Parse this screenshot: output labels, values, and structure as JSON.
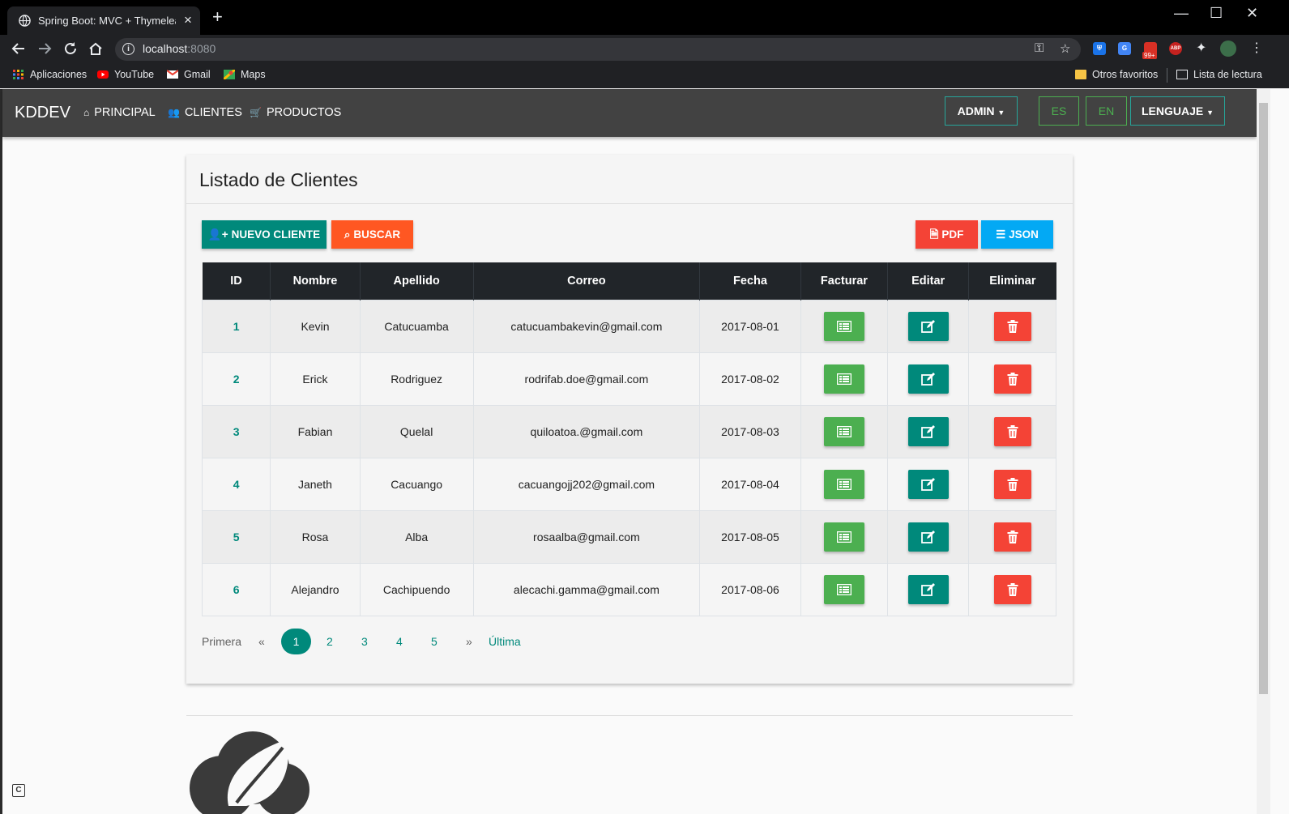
{
  "browser": {
    "tab_title": "Spring Boot: MVC + Thymeleaf +",
    "url_host": "localhost",
    "url_port": ":8080",
    "extension_badge": "99+",
    "abp_label": "ABP",
    "bookmarks": [
      {
        "label": "Aplicaciones",
        "icon": "apps-grid-icon"
      },
      {
        "label": "YouTube",
        "icon": "youtube-icon"
      },
      {
        "label": "Gmail",
        "icon": "gmail-icon"
      },
      {
        "label": "Maps",
        "icon": "maps-icon"
      }
    ],
    "other_bookmarks": "Otros favoritos",
    "reading_list": "Lista de lectura"
  },
  "navbar": {
    "brand": "KDDEV",
    "links": [
      "PRINCIPAL",
      "CLIENTES",
      "PRODUCTOS"
    ],
    "admin": "ADMIN",
    "lang_es": "ES",
    "lang_en": "EN",
    "language": "LENGUAJE"
  },
  "card": {
    "title": "Listado de Clientes",
    "new_client": "NUEVO CLIENTE",
    "search": "BUSCAR",
    "pdf": "PDF",
    "json": "JSON"
  },
  "table": {
    "headers": [
      "ID",
      "Nombre",
      "Apellido",
      "Correo",
      "Fecha",
      "Facturar",
      "Editar",
      "Eliminar"
    ],
    "rows": [
      {
        "id": "1",
        "nombre": "Kevin",
        "apellido": "Catucuamba",
        "correo": "catucuambakevin@gmail.com",
        "fecha": "2017-08-01"
      },
      {
        "id": "2",
        "nombre": "Erick",
        "apellido": "Rodriguez",
        "correo": "rodrifab.doe@gmail.com",
        "fecha": "2017-08-02"
      },
      {
        "id": "3",
        "nombre": "Fabian",
        "apellido": "Quelal",
        "correo": "quiloatoa.@gmail.com",
        "fecha": "2017-08-03"
      },
      {
        "id": "4",
        "nombre": "Janeth",
        "apellido": "Cacuango",
        "correo": "cacuangojj202@gmail.com",
        "fecha": "2017-08-04"
      },
      {
        "id": "5",
        "nombre": "Rosa",
        "apellido": "Alba",
        "correo": "rosaalba@gmail.com",
        "fecha": "2017-08-05"
      },
      {
        "id": "6",
        "nombre": "Alejandro",
        "apellido": "Cachipuendo",
        "correo": "alecachi.gamma@gmail.com",
        "fecha": "2017-08-06"
      }
    ]
  },
  "pagination": {
    "first": "Primera",
    "prev": "«",
    "pages": [
      "1",
      "2",
      "3",
      "4",
      "5"
    ],
    "active_page": "1",
    "next": "»",
    "last": "Última"
  },
  "colors": {
    "teal": "#00897b",
    "orange": "#ff5722",
    "green": "#4caf50",
    "red": "#f44336",
    "blue": "#03a9f4"
  }
}
